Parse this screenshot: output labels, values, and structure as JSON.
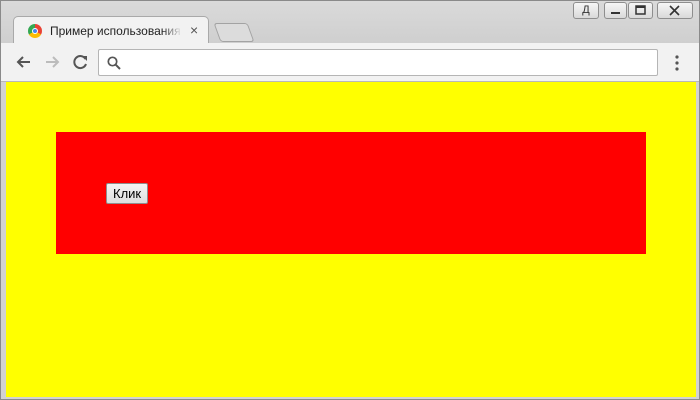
{
  "browser": {
    "tab": {
      "title": "Пример использования jQuery",
      "close_label": "×"
    },
    "window_controls": {
      "profile_label": "Д"
    },
    "toolbar": {
      "address_value": "",
      "address_placeholder": ""
    },
    "colors": {
      "page_background": "#ffff00",
      "box_background": "#ff0000"
    }
  },
  "page": {
    "button_label": "Клик"
  }
}
